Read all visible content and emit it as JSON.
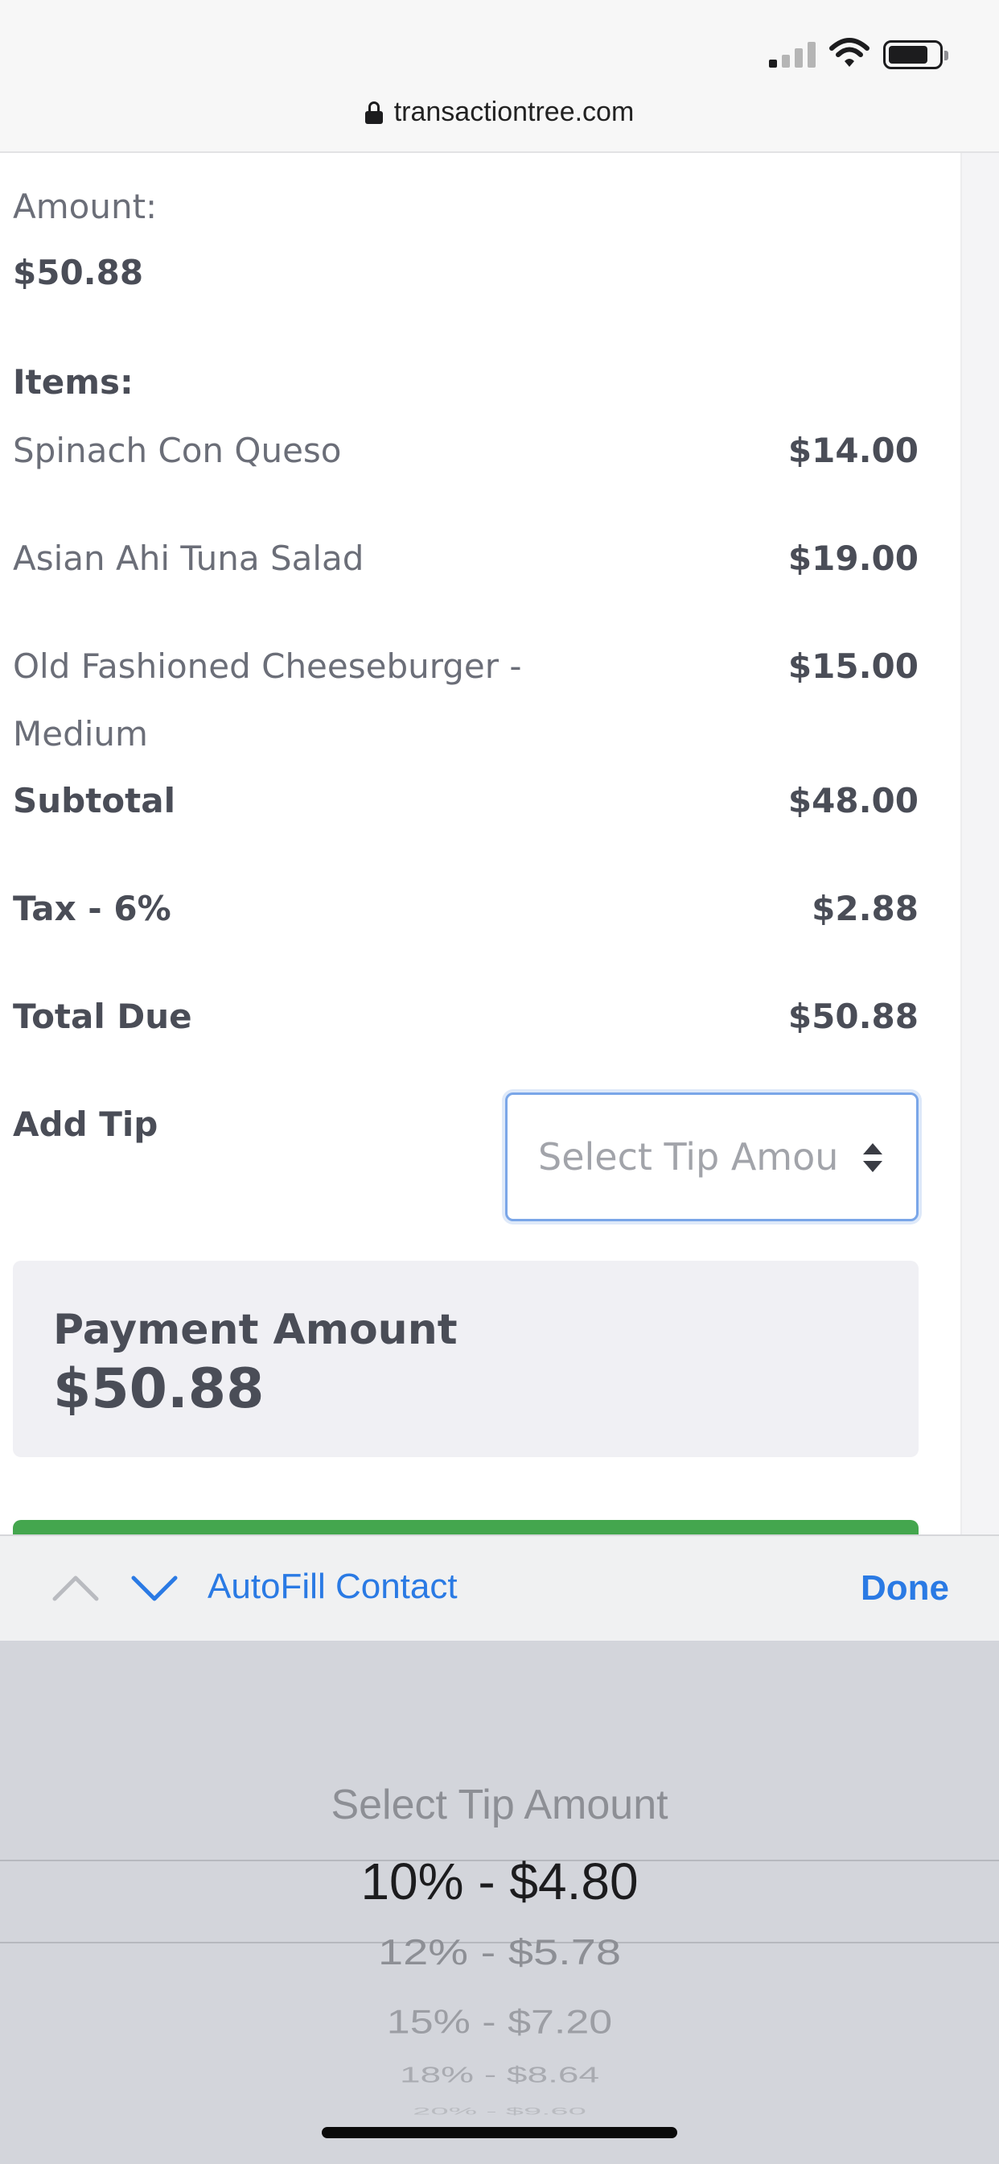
{
  "browser": {
    "url": "transactiontree.com"
  },
  "order": {
    "amount_label": "Amount:",
    "amount_value": "$50.88",
    "items_label": "Items:",
    "items": [
      {
        "name": "Spinach Con Queso",
        "price": "$14.00"
      },
      {
        "name": "Asian Ahi Tuna Salad",
        "price": "$19.00"
      },
      {
        "name": "Old Fashioned Cheeseburger - Medium",
        "price": "$15.00"
      }
    ],
    "subtotal_label": "Subtotal",
    "subtotal_value": "$48.00",
    "tax_label": "Tax - 6%",
    "tax_value": "$2.88",
    "total_label": "Total Due",
    "total_value": "$50.88"
  },
  "tip": {
    "label": "Add Tip",
    "select_placeholder": "Select Tip Amou"
  },
  "payment": {
    "label": "Payment Amount",
    "value": "$50.88"
  },
  "toolbar": {
    "autofill_label": "AutoFill Contact",
    "done_label": "Done"
  },
  "picker": {
    "options": [
      "Select Tip Amount",
      "10% - $4.80",
      "12% - $5.78",
      "15% - $7.20",
      "18% - $8.64",
      "20% - $9.60"
    ],
    "selected_index": 1
  },
  "colors": {
    "accent_blue": "#2a7ae4",
    "pay_green": "#44a64e",
    "text_dark": "#4a4d57",
    "text_light": "#6b6e78"
  }
}
